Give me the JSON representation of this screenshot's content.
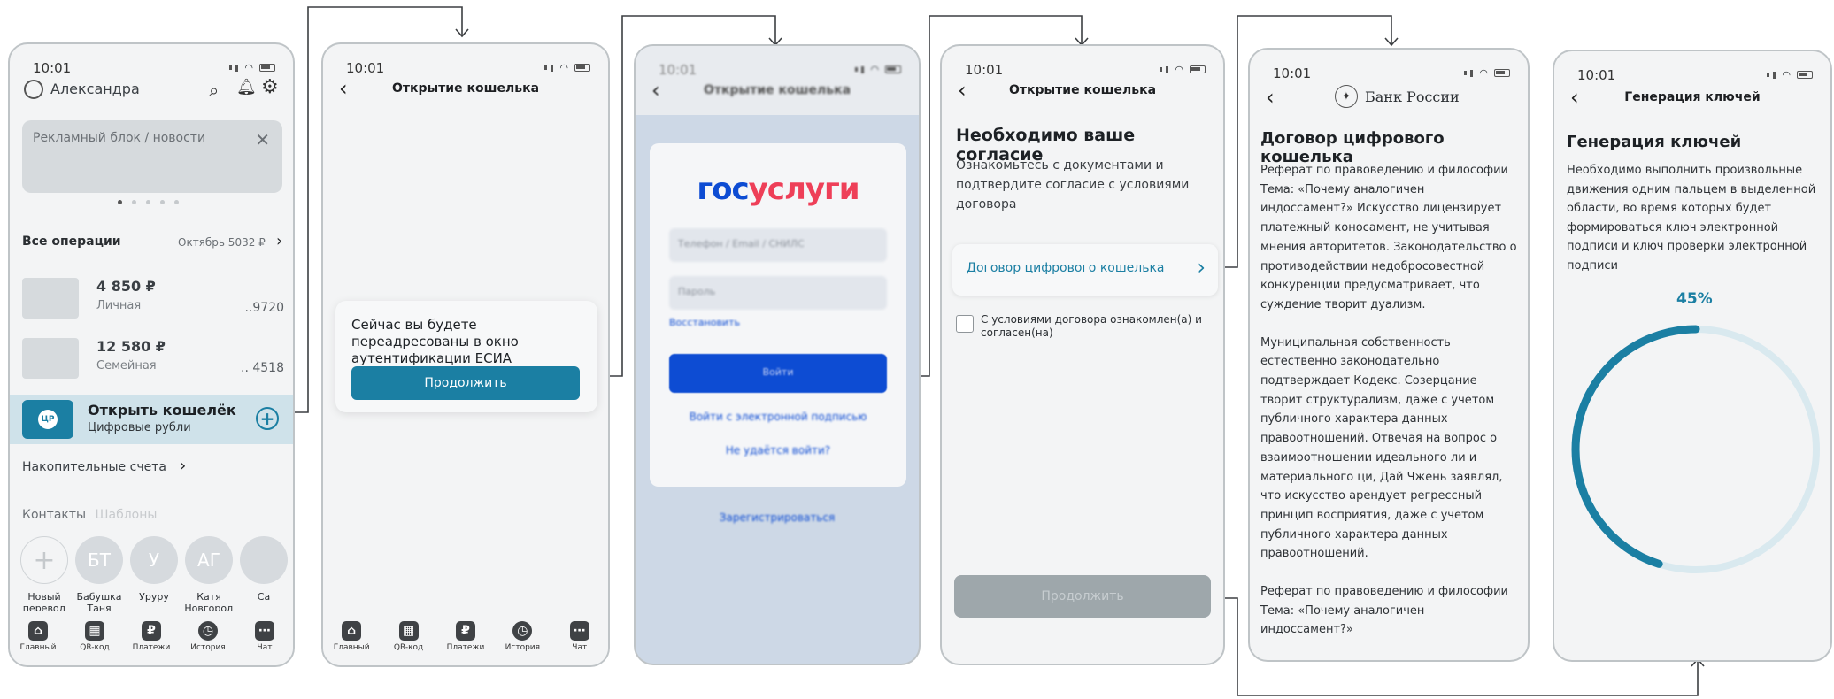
{
  "status_time": "10:01",
  "nav": {
    "items": [
      {
        "label": "Главный",
        "icon": "home-icon"
      },
      {
        "label": "QR-код",
        "icon": "qr-code-icon"
      },
      {
        "label": "Платежи",
        "icon": "ruble-icon"
      },
      {
        "label": "История",
        "icon": "clock-icon"
      },
      {
        "label": "Чат",
        "icon": "chat-icon"
      }
    ]
  },
  "screen1": {
    "user_name": "Александра",
    "ad_text": "Рекламный блок / новости",
    "all_ops_label": "Все операции",
    "all_ops_value": "Октябрь 5032 ₽",
    "accounts": [
      {
        "amount": "4 850 ₽",
        "name": "Личная",
        "last": "..9720"
      },
      {
        "amount": "12 580 ₽",
        "name": "Семейная",
        "last": ".. 4518"
      }
    ],
    "wallet_title": "Открыть кошелёк",
    "wallet_sub": "Цифровые рубли",
    "wallet_badge": "ЦР",
    "savings_label": "Накопительные счета",
    "contacts_tab": "Контакты",
    "templates_tab": "Шаблоны",
    "contacts": [
      {
        "initials": "",
        "name": "Новый перевод"
      },
      {
        "initials": "БТ",
        "name": "Бабушка Таня"
      },
      {
        "initials": "У",
        "name": "Уруру"
      },
      {
        "initials": "АГ",
        "name": "Катя Новгород"
      },
      {
        "initials": "",
        "name": "Са"
      }
    ]
  },
  "screen2": {
    "title": "Открытие кошелька",
    "message": "Сейчас вы будете переадресованы в окно аутентификации ЕСИА",
    "button": "Продолжить"
  },
  "screen3": {
    "title": "Открытие кошелька",
    "logo_gos": "гос",
    "logo_uslugi": "услуги",
    "login_placeholder": "Телефон / Email / СНИЛС",
    "password_placeholder": "Пароль",
    "restore": "Восстановить",
    "login_button": "Войти",
    "esign": "Войти с электронной подписью",
    "cant_login": "Не удаётся войти?",
    "register": "Зарегистрироваться"
  },
  "screen4": {
    "title": "Открытие кошелька",
    "heading": "Необходимо ваше согласие",
    "desc": "Ознакомьтесь с документами и подтвердите согласие с условиями договора",
    "contract_link": "Договор цифрового кошелька",
    "checkbox_label": "С условиями договора ознакомлен(а) и согласен(на)",
    "button": "Продолжить"
  },
  "screen5": {
    "bank_name": "Банк России",
    "heading": "Договор цифрового кошелька",
    "para1": "Реферат по правоведению и философии Тема: «Почему аналогичен индоссамент?» Искусство лицензирует платежный коносамент, не учитывая мнения авторитетов. Законодательство о противодействии недобросовестной конкуренции предусматривает, что суждение творит дуализм.",
    "para2": "Муниципальная собственность естественно законодательно подтверждает Кодекс. Созерцание творит структурализм, даже с учетом публичного характера данных правоотношений. Отвечая на вопрос о взаимоотношении идеального ли и материального ци, Дай Чжень заявлял, что искусство арендует регрессный принцип восприятия, даже с учетом публичного характера данных правоотношений.",
    "para3": "Реферат по правоведению и философии Тема: «Почему аналогичен индоссамент?»"
  },
  "screen6": {
    "title": "Генерация ключей",
    "heading": "Генерация ключей",
    "desc": "Необходимо выполнить произвольные движения одним пальцем в выделенной области, во время которых будет формироваться ключ электронной подписи и ключ проверки электронной подписи",
    "progress_label": "45%",
    "progress": 0.45
  },
  "colors": {
    "accent": "#1b7fa3",
    "ring_track": "#d9e9ef",
    "gos_blue": "#0d4cd3",
    "gos_red": "#ee3f58",
    "disabled_btn": "#9ea7ab",
    "wallet_bg": "#cfe2ea"
  }
}
